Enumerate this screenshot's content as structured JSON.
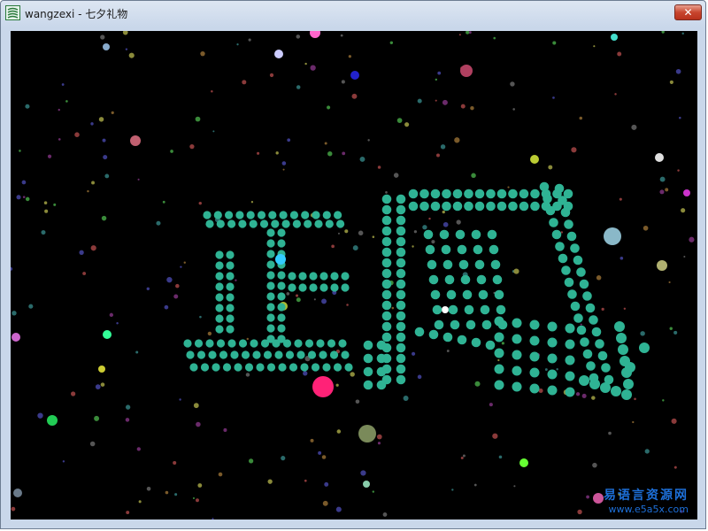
{
  "window": {
    "title": "wangzexi - 七夕礼物",
    "close_glyph": "✕",
    "icon": "app-icon"
  },
  "canvas": {
    "background": "#000000",
    "dot_color": "#2fb394",
    "chars": "正阳",
    "description_colors": [
      "#ff3385",
      "#4dd2ff",
      "#9acd32",
      "#cc66ff",
      "#ff99cc",
      "#66ffcc",
      "#ffcc00"
    ]
  },
  "watermark": {
    "line1": "易语言资源网",
    "line2": "www.e5a5x.com",
    "color": "#1d6fd8"
  }
}
